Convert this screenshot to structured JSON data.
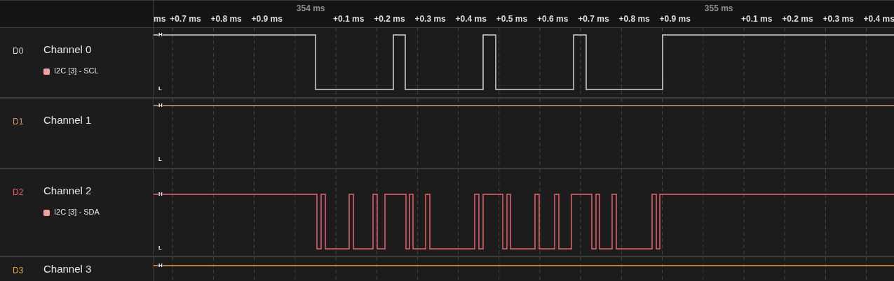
{
  "timeline": {
    "ticks": [
      {
        "label": "ms",
        "kind": "offset"
      },
      {
        "label": "+0.7 ms",
        "kind": "offset"
      },
      {
        "label": "+0.8 ms",
        "kind": "offset"
      },
      {
        "label": "+0.9 ms",
        "kind": "offset"
      },
      {
        "label": "354 ms",
        "kind": "major"
      },
      {
        "label": "+0.1 ms",
        "kind": "offset"
      },
      {
        "label": "+0.2 ms",
        "kind": "offset"
      },
      {
        "label": "+0.3 ms",
        "kind": "offset"
      },
      {
        "label": "+0.4 ms",
        "kind": "offset"
      },
      {
        "label": "+0.5 ms",
        "kind": "offset"
      },
      {
        "label": "+0.6 ms",
        "kind": "offset"
      },
      {
        "label": "+0.7 ms",
        "kind": "offset"
      },
      {
        "label": "+0.8 ms",
        "kind": "offset"
      },
      {
        "label": "+0.9 ms",
        "kind": "offset"
      },
      {
        "label": "355 ms",
        "kind": "major"
      },
      {
        "label": "+0.1 ms",
        "kind": "offset"
      },
      {
        "label": "+0.2 ms",
        "kind": "offset"
      },
      {
        "label": "+0.3 ms",
        "kind": "offset"
      },
      {
        "label": "+0.4 ms",
        "kind": "offset"
      }
    ]
  },
  "channels": [
    {
      "id": "D0",
      "name": "Channel 0",
      "color": "#d4d4d4",
      "kind": "clock",
      "high_label": "H",
      "low_label": "L",
      "analyzer": {
        "label": "I2C [3] - SCL",
        "color": "#f4a0a0"
      }
    },
    {
      "id": "D1",
      "name": "Channel 1",
      "color": "#d09a70",
      "kind": "idle",
      "high_label": "H",
      "low_label": "L"
    },
    {
      "id": "D2",
      "name": "Channel 2",
      "color": "#e8606e",
      "kind": "data",
      "high_label": "H",
      "low_label": "L",
      "analyzer": {
        "label": "I2C [3] - SDA",
        "color": "#f4a0a0"
      }
    },
    {
      "id": "D3",
      "name": "Channel 3",
      "color": "#e8a040",
      "kind": "idle",
      "high_label": "H"
    }
  ]
}
